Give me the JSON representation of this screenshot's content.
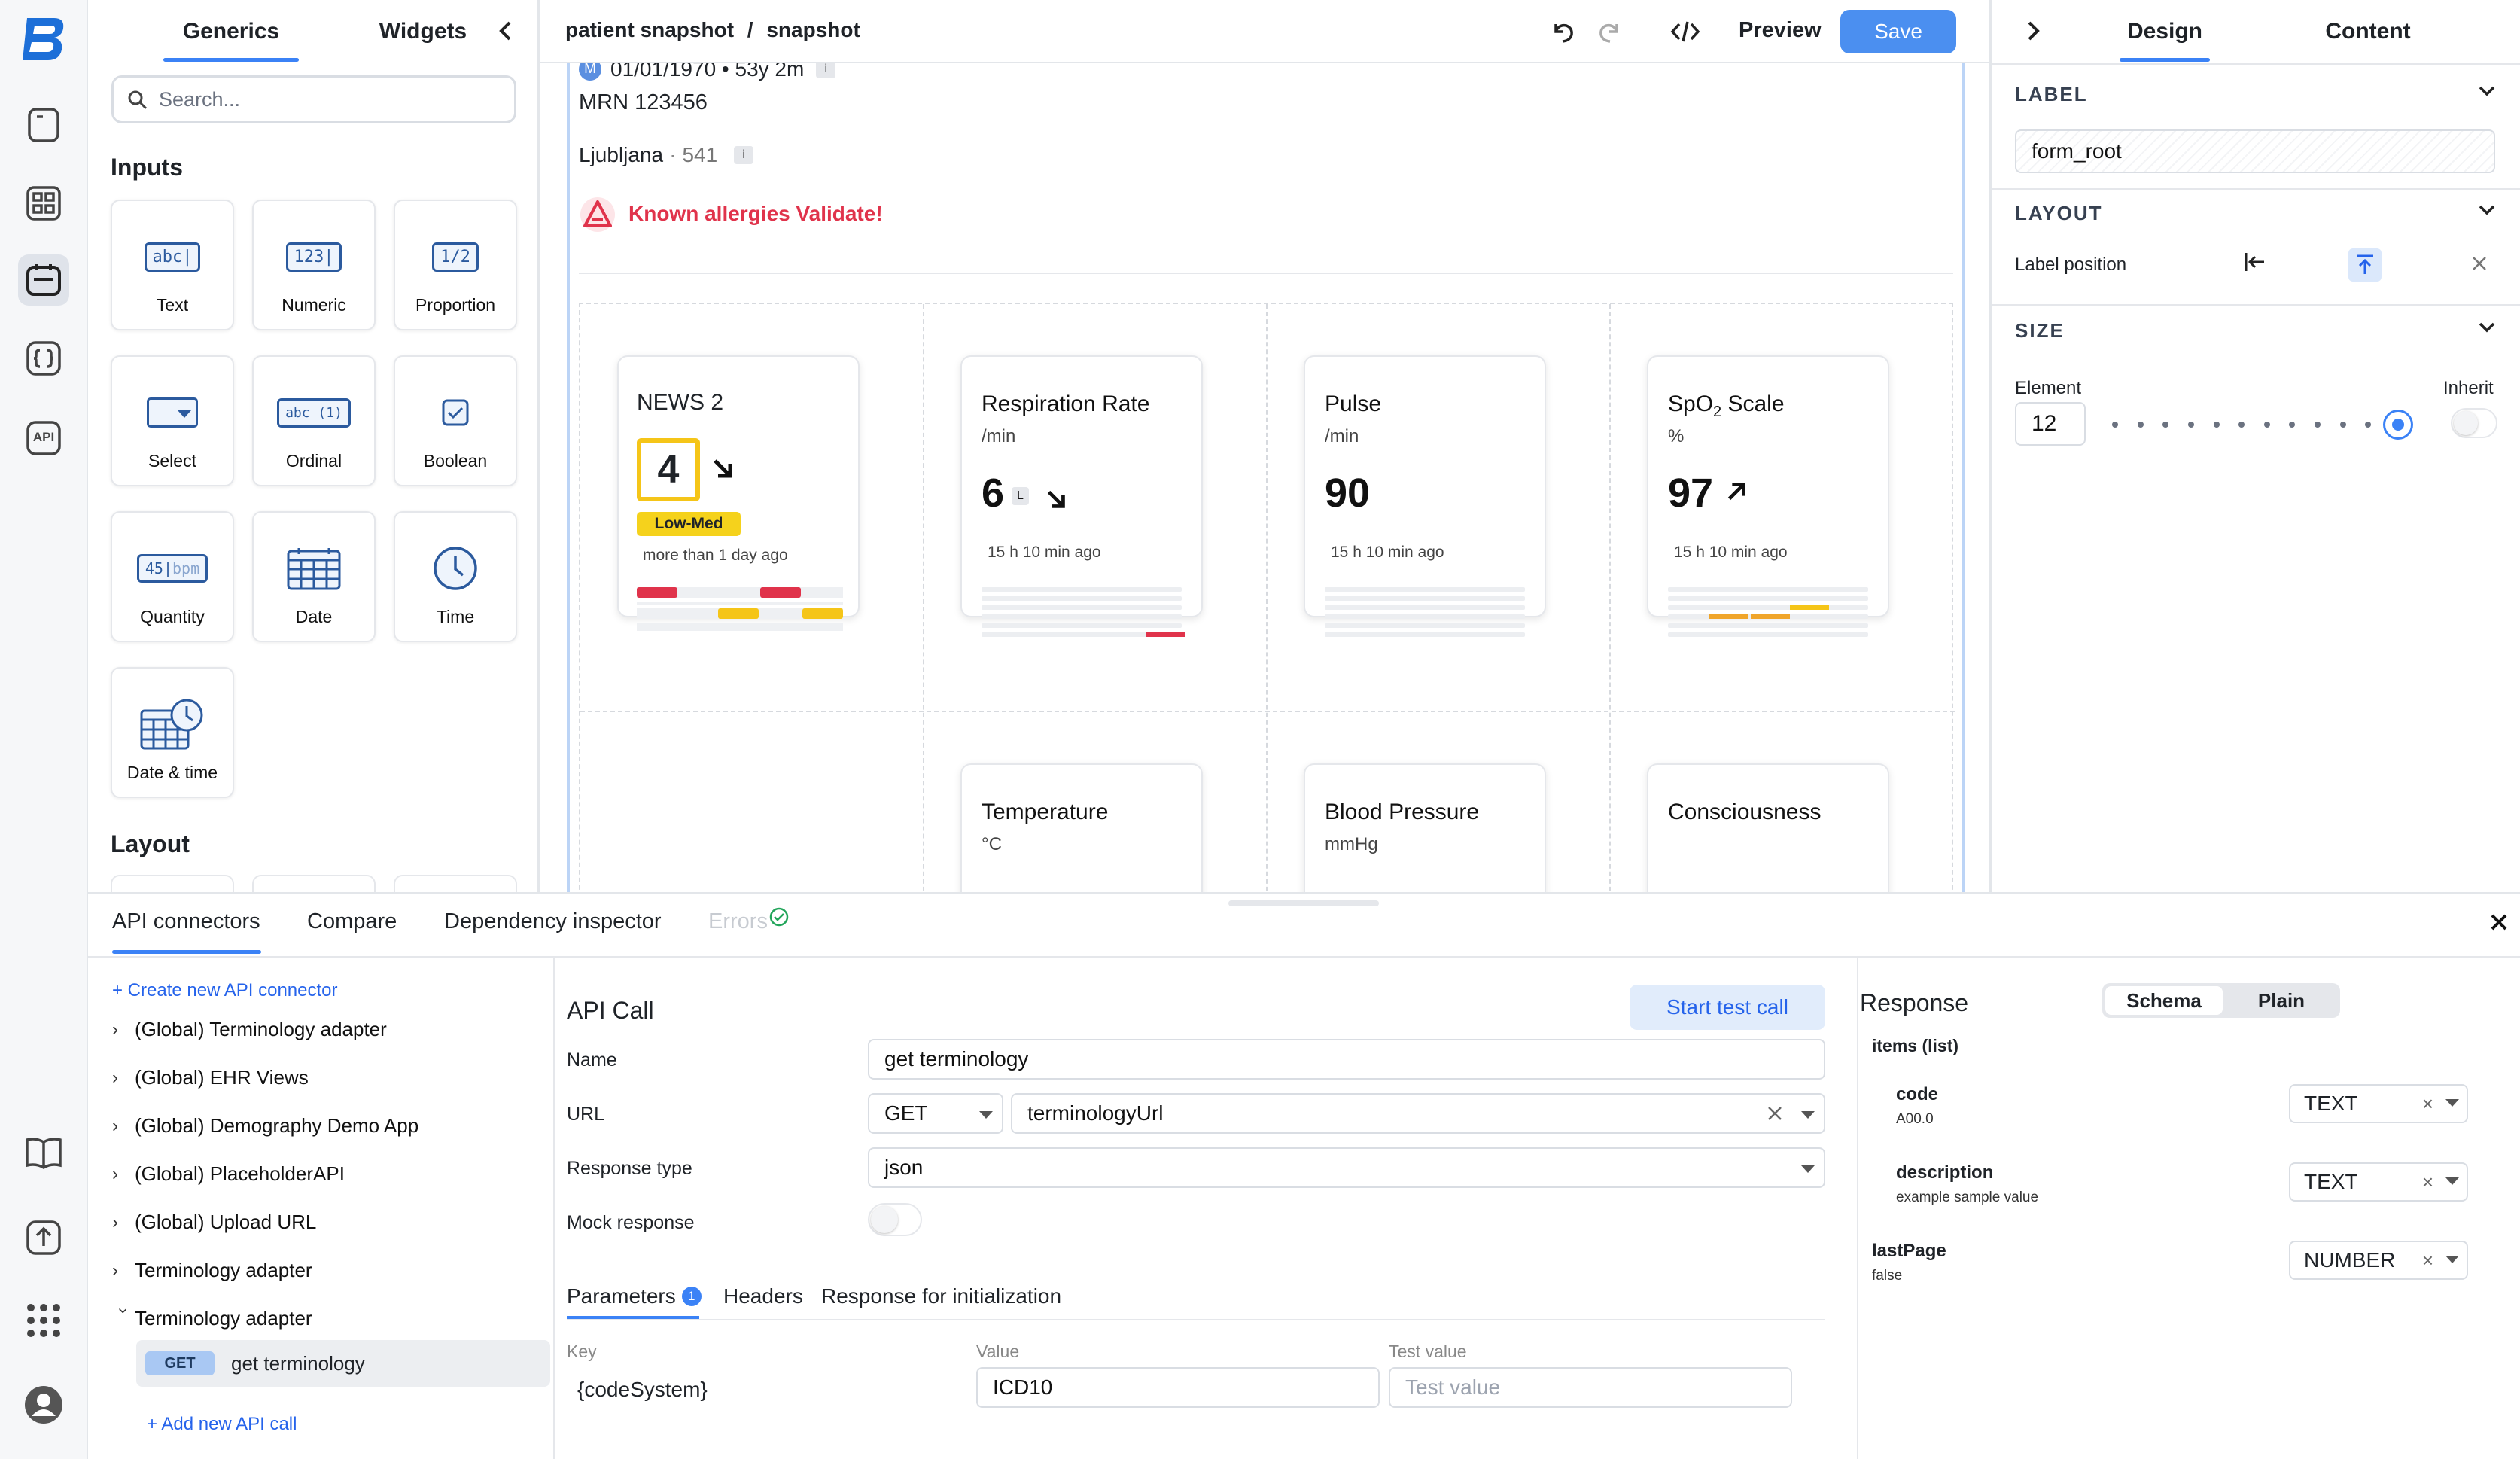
{
  "rail": {
    "logo": "B",
    "icons": [
      "document-icon",
      "components-icon",
      "form-icon",
      "braces-icon",
      "api-icon",
      "book-icon",
      "upload-icon",
      "apps-grid-icon",
      "user-avatar-icon"
    ],
    "api_label": "API"
  },
  "left_panel": {
    "tabs": [
      "Generics",
      "Widgets"
    ],
    "search_placeholder": "Search...",
    "inputs_title": "Inputs",
    "layout_title": "Layout",
    "tiles": [
      {
        "label": "Text",
        "glyph": "abc|"
      },
      {
        "label": "Numeric",
        "glyph": "123|"
      },
      {
        "label": "Proportion",
        "glyph": "1/2"
      },
      {
        "label": "Select",
        "glyph": ""
      },
      {
        "label": "Ordinal",
        "glyph": "abc (1)"
      },
      {
        "label": "Boolean",
        "glyph": ""
      },
      {
        "label": "Quantity",
        "glyph": "45|",
        "glyph_unit": "bpm"
      },
      {
        "label": "Date",
        "glyph": ""
      },
      {
        "label": "Time",
        "glyph": ""
      },
      {
        "label": "Date & time",
        "glyph": ""
      }
    ]
  },
  "toolbar": {
    "breadcrumb": "patient snapshot",
    "separator": "/",
    "current": "snapshot",
    "preview": "Preview",
    "save": "Save"
  },
  "canvas": {
    "patient": {
      "badge": "M",
      "dob": "01/01/1970 • 53y 2m",
      "mrn": "MRN 123456",
      "location": "Ljubljana",
      "location_dot": "·",
      "location_code": "541",
      "info": "i",
      "allergy": "Known allergies Validate!"
    },
    "cards": [
      {
        "title": "NEWS 2",
        "unit": "",
        "value": "4",
        "badge": "Low-Med",
        "ago": "more than 1 day ago",
        "trend": "down-right"
      },
      {
        "title": "Respiration Rate",
        "unit": "/min",
        "value": "6",
        "flag": "L",
        "ago": "15 h 10 min ago",
        "trend": "down-right"
      },
      {
        "title": "Pulse",
        "unit": "/min",
        "value": "90",
        "ago": "15 h 10 min ago"
      },
      {
        "title": "SpO",
        "title_sub": "2",
        "title_suffix": " Scale",
        "unit": "%",
        "value": "97",
        "ago": "15 h 10 min ago",
        "trend": "up-right"
      },
      {
        "title": "Temperature",
        "unit": "°C"
      },
      {
        "title": "Blood Pressure",
        "unit": "mmHg"
      },
      {
        "title": "Consciousness",
        "unit": ""
      }
    ]
  },
  "right_panel": {
    "tabs": [
      "Design",
      "Content"
    ],
    "label_section": "LABEL",
    "label_value": "form_root",
    "layout_section": "LAYOUT",
    "label_position": "Label position",
    "size_section": "SIZE",
    "element_label": "Element",
    "inherit_label": "Inherit",
    "element_value": "12",
    "slider_fraction": 1.0
  },
  "bottom": {
    "tabs": [
      "API connectors",
      "Compare",
      "Dependency inspector",
      "Errors"
    ],
    "create_connector": "+ Create new API connector",
    "connectors": [
      "(Global) Terminology adapter",
      "(Global) EHR Views",
      "(Global) Demography Demo App",
      "(Global) PlaceholderAPI",
      "(Global) Upload URL",
      "Terminology adapter",
      "Terminology adapter"
    ],
    "selected_call": {
      "method": "GET",
      "name": "get terminology"
    },
    "add_call": "+ Add new API call",
    "api_call": {
      "title": "API Call",
      "start_test": "Start test call",
      "name_label": "Name",
      "name_value": "get terminology",
      "url_label": "URL",
      "method_value": "GET",
      "url_value": "terminologyUrl",
      "response_type_label": "Response type",
      "response_type_value": "json",
      "mock_label": "Mock response",
      "subtabs": [
        "Parameters",
        "Headers",
        "Response for initialization"
      ],
      "param_count": "1",
      "col_key": "Key",
      "col_value": "Value",
      "col_test": "Test value",
      "param_key": "{codeSystem}",
      "param_value": "ICD10",
      "param_test_placeholder": "Test value"
    },
    "response": {
      "title": "Response",
      "toggle": [
        "Schema",
        "Plain"
      ],
      "root": "items (list)",
      "fields": [
        {
          "name": "code",
          "example": "A00.0",
          "type": "TEXT"
        },
        {
          "name": "description",
          "example": "example sample value",
          "type": "TEXT"
        },
        {
          "name": "lastPage",
          "example": "false",
          "type": "NUMBER"
        }
      ]
    }
  },
  "colors": {
    "accent": "#3b82f6",
    "danger": "#e0334b",
    "warn": "#f5c518",
    "muted": "#6b7280"
  }
}
